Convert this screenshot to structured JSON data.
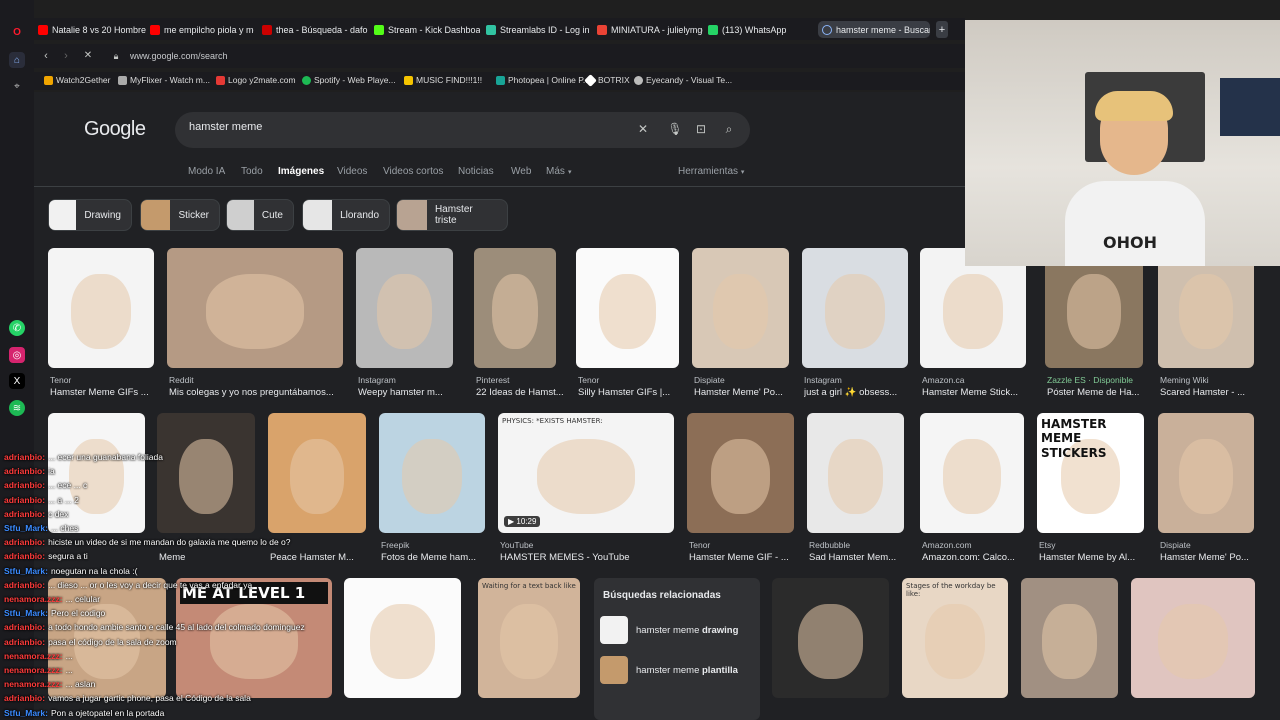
{
  "tabs": [
    {
      "label": "Natalie 8 vs 20 Hombres (",
      "color": "#ff0000"
    },
    {
      "label": "me empilcho piola y me p",
      "color": "#ff0000"
    },
    {
      "label": "thea - Búsqueda - dafont.",
      "color": "#cc0000"
    },
    {
      "label": "Stream - Kick Dashboard",
      "color": "#53fc18"
    },
    {
      "label": "Streamlabs ID - Log in",
      "color": "#31c3a2"
    },
    {
      "label": "MINIATURA - julielymgon",
      "color": "#ea4335"
    },
    {
      "label": "(113) WhatsApp",
      "color": "#25d366"
    },
    {
      "label": "hamster meme - Buscar c",
      "color": "#8ab4f8"
    }
  ],
  "address": {
    "url": "www.google.com/search"
  },
  "bookmarks": [
    {
      "label": "Watch2Gether",
      "color": "#f0a500"
    },
    {
      "label": "MyFlixer - Watch m...",
      "color": "#aaaaaa"
    },
    {
      "label": "Logo y2mate.com",
      "color": "#e53935"
    },
    {
      "label": "Spotify - Web Playe...",
      "color": "#1db954"
    },
    {
      "label": "MUSIC FIND!!!1!!",
      "color": "#f5c400"
    },
    {
      "label": "Photopea | Online P...",
      "color": "#18a497"
    },
    {
      "label": "BOTRIX",
      "color": "#ffffff"
    },
    {
      "label": "Eyecandy - Visual Te...",
      "color": "#bbbbbb"
    }
  ],
  "google": {
    "logo": "Google",
    "query": "hamster meme",
    "nav": [
      "Modo IA",
      "Todo",
      "Imágenes",
      "Videos",
      "Videos cortos",
      "Noticias",
      "Web",
      "Más"
    ],
    "tools": "Herramientas",
    "chips": [
      "Drawing",
      "Sticker",
      "Cute",
      "Llorando",
      "Hamster triste"
    ]
  },
  "row1": [
    {
      "source": "Tenor",
      "title": "Hamster Meme GIFs ...",
      "color": "#f4f4f4"
    },
    {
      "source": "Reddit",
      "title": "Mis colegas y yo nos preguntábamos...",
      "color": "#b59a84"
    },
    {
      "source": "Instagram",
      "title": "Weepy hamster m...",
      "color": "#b9b9b9"
    },
    {
      "source": "Pinterest",
      "title": "22 Ideas de Hamst...",
      "color": "#9c8d7a"
    },
    {
      "source": "Tenor",
      "title": "Silly Hamster GIFs |...",
      "color": "#fafafa"
    },
    {
      "source": "Dispiate",
      "title": "Hamster Meme' Po...",
      "color": "#d8c8b6"
    },
    {
      "source": "Instagram",
      "title": "just a girl ✨ obsess...",
      "color": "#d9dde2"
    },
    {
      "source": "Amazon.ca",
      "title": "Hamster Meme Stick...",
      "color": "#f3f3f3"
    },
    {
      "source": "Zazzle ES · Disponible",
      "title": "Póster Meme de Ha...",
      "color": "#8a7760"
    },
    {
      "source": "Meming Wiki",
      "title": "Scared Hamster - ...",
      "color": "#cfbfae"
    }
  ],
  "row2": [
    {
      "source": "",
      "title": "",
      "color": "#f6f6f6"
    },
    {
      "source": "",
      "title": "Meme",
      "color": "#3a3430"
    },
    {
      "source": "",
      "title": "Peace Hamster M...",
      "color": "#d9a36b"
    },
    {
      "source": "Freepik",
      "title": "Fotos de Meme ham...",
      "color": "#bcd4e2"
    },
    {
      "source": "YouTube",
      "title": "HAMSTER MEMES - YouTube",
      "color": "#f4f4f4",
      "overlay": "PHYSICS: *EXISTS HAMSTER:",
      "badge": "10:29"
    },
    {
      "source": "Tenor",
      "title": "Hamster Meme GIF - ...",
      "color": "#8c6e56"
    },
    {
      "source": "Redbubble",
      "title": "Sad Hamster Mem...",
      "color": "#e8e8e8"
    },
    {
      "source": "Amazon.com",
      "title": "Amazon.com: Calco...",
      "color": "#f5f5f5"
    },
    {
      "source": "Etsy",
      "title": "Hamster Meme by Al...",
      "color": "#ffffff",
      "overlay": "HAMSTER MEME STICKERS"
    },
    {
      "source": "Dispiate",
      "title": "Hamster Meme' Po...",
      "color": "#c9b09a"
    }
  ],
  "row3": [
    {
      "overlay": "",
      "color": "#c8a585"
    },
    {
      "overlay": "ME AT LEVEL 1",
      "color": "#c48a76"
    },
    {
      "overlay": "",
      "color": "#fbfbfb"
    },
    {
      "overlay": "Waiting for a text back like",
      "color": "#d1b49a"
    },
    {
      "overlay": "",
      "color": "#2b2b2b"
    },
    {
      "overlay": "Stages of the workday be like:",
      "color": "#e8d7c5"
    },
    {
      "overlay": "",
      "color": "#a19082"
    },
    {
      "overlay": "",
      "color": "#e0c5c0"
    }
  ],
  "related": {
    "heading": "Búsquedas relacionadas",
    "items": [
      {
        "prefix": "hamster meme",
        "bold": "drawing"
      },
      {
        "prefix": "hamster meme",
        "bold": "plantilla"
      }
    ]
  },
  "chat": [
    {
      "user": "adrianbio:",
      "msg": "... ecer una guanabana foliada",
      "ucolor": "#ff3b3b"
    },
    {
      "user": "adrianbio:",
      "msg": "ia",
      "ucolor": "#ff3b3b"
    },
    {
      "user": "adrianbio:",
      "msg": "... ece ... c",
      "ucolor": "#ff3b3b"
    },
    {
      "user": "adrianbio:",
      "msg": "... a ... 2",
      "ucolor": "#ff3b3b"
    },
    {
      "user": "adrianbio:",
      "msg": "c dex",
      "ucolor": "#ff3b3b"
    },
    {
      "user": "Stfu_Mark:",
      "msg": "... ches",
      "ucolor": "#3b8bff"
    },
    {
      "user": "adrianbio:",
      "msg": "hiciste un video de si me mandan do galaxia me quemo lo de o?",
      "ucolor": "#ff3b3b"
    },
    {
      "user": "adrianbio:",
      "msg": "segura a ti",
      "ucolor": "#ff3b3b"
    },
    {
      "user": "Stfu_Mark:",
      "msg": "noegutan na la chola :(",
      "ucolor": "#3b8bff"
    },
    {
      "user": "adrianbio:",
      "msg": "... dieso ... or o les voy a decir que te vas a enfadar ya",
      "ucolor": "#ff3b3b"
    },
    {
      "user": "nenamora.zzz:",
      "msg": "... celular",
      "ucolor": "#ff3b3b"
    },
    {
      "user": "Stfu_Mark:",
      "msg": "Pero el codigo",
      "ucolor": "#3b8bff"
    },
    {
      "user": "adrianbio:",
      "msg": "a todo hondo ambie santo e calle 45 al lado del colmado dominguez",
      "ucolor": "#ff3b3b"
    },
    {
      "user": "adrianbio:",
      "msg": "pasa el código de la sala de zoom",
      "ucolor": "#ff3b3b"
    },
    {
      "user": "nenamora.zzz:",
      "msg": "...",
      "ucolor": "#ff3b3b"
    },
    {
      "user": "nenamora.zzz:",
      "msg": "...",
      "ucolor": "#ff3b3b"
    },
    {
      "user": "nenamora.zzz:",
      "msg": "... aslan",
      "ucolor": "#ff3b3b"
    },
    {
      "user": "adrianbio:",
      "msg": "vamos a jugar gartic phone, pasa el Código de la sala",
      "ucolor": "#ff3b3b"
    },
    {
      "user": "Stfu_Mark:",
      "msg": "Pon a ojetopatel en la portada",
      "ucolor": "#3b8bff"
    }
  ]
}
